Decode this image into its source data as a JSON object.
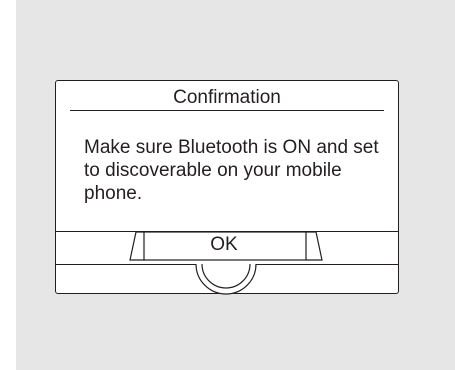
{
  "dialog": {
    "title": "Confirmation",
    "message": "Make sure Bluetooth is ON and set to discoverable on your mobile phone.",
    "ok_label": "OK"
  },
  "colors": {
    "screen_background": "#e6e6e6",
    "dialog_background": "#ffffff",
    "line": "#231f20"
  }
}
